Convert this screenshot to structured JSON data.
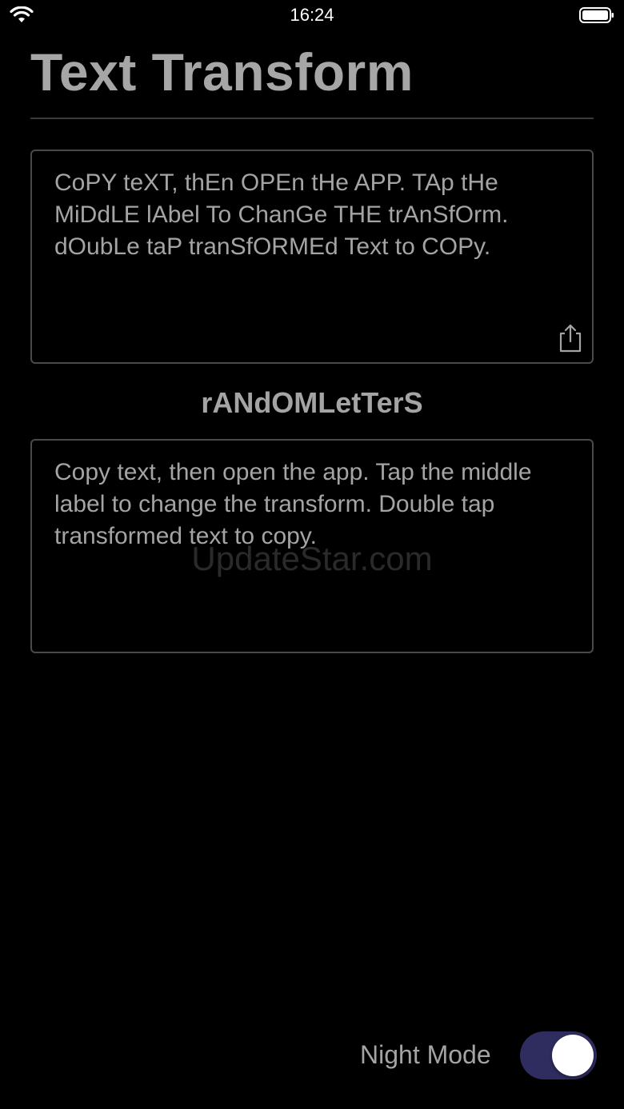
{
  "status_bar": {
    "time": "16:24",
    "wifi_icon": "wifi-icon",
    "battery_icon": "battery-icon"
  },
  "header": {
    "title": "Text Transform"
  },
  "input": {
    "text": "CoPY teXT, thEn OPEn tHe APP. TAp tHe MiDdLE lAbel To ChanGe THE trAnSfOrm. dOubLe taP tranSfORMEd Text to COPy.",
    "share_icon": "share-icon"
  },
  "transform": {
    "label": "rANdOMLetTerS"
  },
  "output": {
    "text": "Copy text, then open the app. Tap the middle label to change the transform. Double tap transformed text to copy."
  },
  "watermark": {
    "text": "UpdateStar.com"
  },
  "footer": {
    "night_mode_label": "Night Mode",
    "night_mode_on": true
  },
  "colors": {
    "background": "#000000",
    "text": "#a4a4a4",
    "toggle_on": "#2f2c5f",
    "border": "#4a4a4a"
  }
}
